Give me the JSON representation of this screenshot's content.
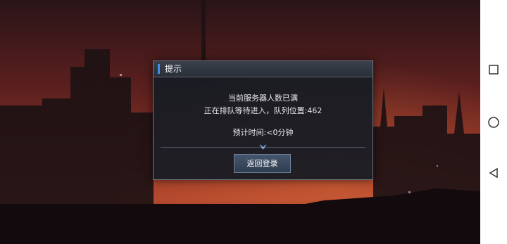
{
  "dialog": {
    "title": "提示",
    "message_line1": "当前服务器人数已满",
    "message_line2": "正在排队等待进入，队列位置:462",
    "estimate": "预计时间:<0分钟",
    "return_button_label": "返回登录"
  },
  "navbar": {
    "buttons": [
      "square-icon",
      "circle-icon",
      "back-triangle-icon"
    ]
  },
  "colors": {
    "accent": "#3f8ee8",
    "dialog_bg": "#181c24",
    "sky": "#7a2a26"
  }
}
